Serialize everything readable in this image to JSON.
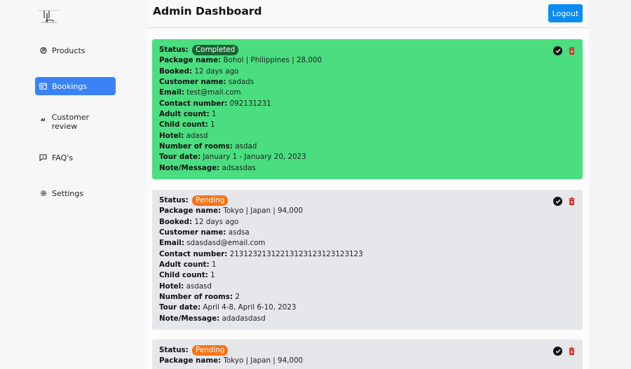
{
  "header": {
    "title": "Admin Dashboard",
    "logout_label": "Logout"
  },
  "sidebar": {
    "items": [
      {
        "label": "Products",
        "icon": "products-icon",
        "active": false
      },
      {
        "label": "Bookings",
        "icon": "calendar-icon",
        "active": true
      },
      {
        "label": "Customer review",
        "icon": "quote-icon",
        "active": false
      },
      {
        "label": "FAQ's",
        "icon": "faq-icon",
        "active": false
      },
      {
        "label": "Settings",
        "icon": "gear-icon",
        "active": false
      }
    ]
  },
  "labels": {
    "status": "Status:",
    "package": "Package name:",
    "booked": "Booked:",
    "customer": "Customer name:",
    "email": "Email:",
    "contact": "Contact number:",
    "adult": "Adult count:",
    "child": "Child count:",
    "hotel": "Hotel:",
    "rooms": "Number of rooms:",
    "tour": "Tour date:",
    "note": "Note/Message:"
  },
  "bookings": [
    {
      "status": "Completed",
      "package": "Bohol | Philippines | 28,000",
      "booked": "12 days ago",
      "customer": "sadads",
      "email": "test@mail.com",
      "contact": "092131231",
      "adult": "1",
      "child": "1",
      "hotel": "adasd",
      "rooms": "asdad",
      "tour": "January 1 - January 20, 2023",
      "note": "adsasdas"
    },
    {
      "status": "Pending",
      "package": "Tokyo | Japan | 94,000",
      "booked": "12 days ago",
      "customer": "asdsa",
      "email": "sdasdasd@email.com",
      "contact": "21312321312213123123123123123",
      "adult": "1",
      "child": "1",
      "hotel": "asdasd",
      "rooms": "2",
      "tour": "April 4-8, April 6-10, 2023",
      "note": "adadasdasd"
    },
    {
      "status": "Pending",
      "package": "Tokyo | Japan | 94,000"
    }
  ],
  "colors": {
    "completed_card": "#4ade80",
    "completed_badge": "#166534",
    "pending_card": "#e5e7eb",
    "pending_badge": "#f97316",
    "active_nav": "#3b82f6",
    "logout": "#0a8cf0",
    "trash": "#dc2626"
  }
}
